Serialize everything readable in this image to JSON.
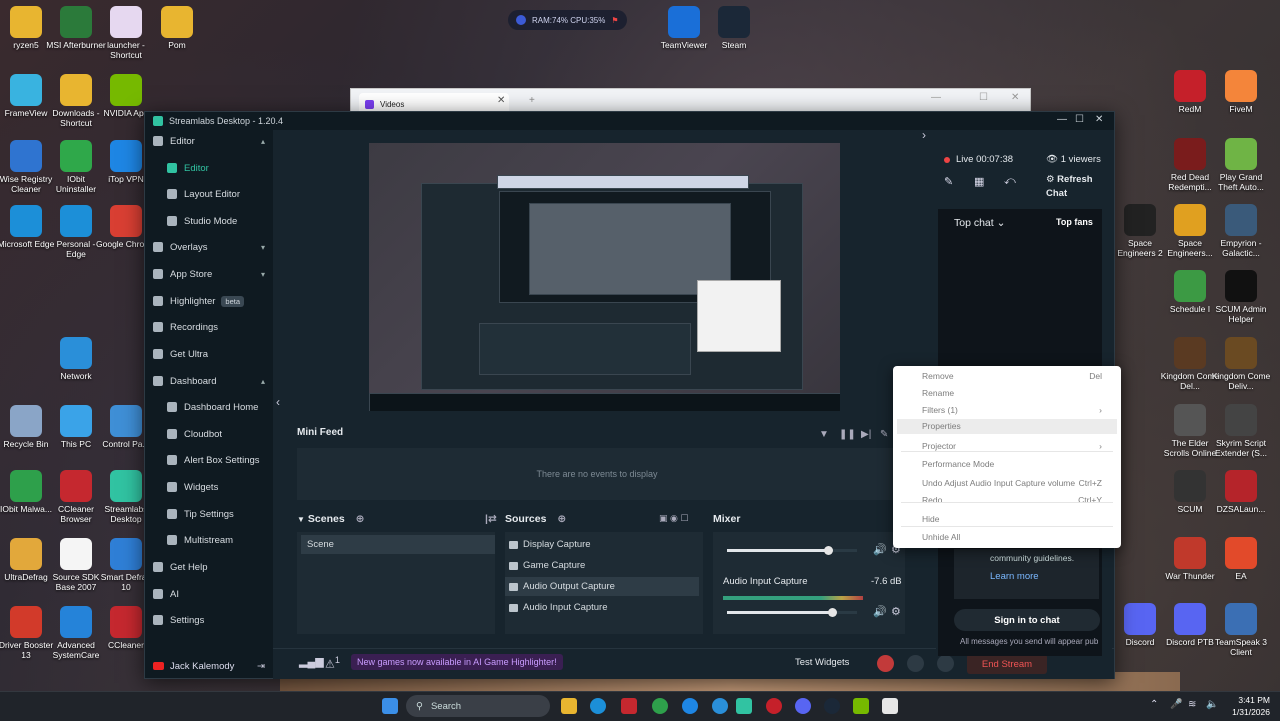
{
  "desktop_left": [
    {
      "label": "ryzen5",
      "color": "#e8b530",
      "glyph": "folder-icon"
    },
    {
      "label": "MSI Afterburner",
      "color": "#2b7a3a",
      "glyph": "afterburner-icon"
    },
    {
      "label": "launcher - Shortcut",
      "color": "#e6d8f0",
      "glyph": "launcher-icon"
    },
    {
      "label": "Pom",
      "color": "#e8b530",
      "glyph": "folder-icon"
    },
    {
      "label": "FrameView",
      "color": "#39b3e0",
      "glyph": "frameview-icon"
    },
    {
      "label": "Downloads - Shortcut",
      "color": "#e8b530",
      "glyph": "folder-icon"
    },
    {
      "label": "NVIDIA App",
      "color": "#76b900",
      "glyph": "nvidia-icon"
    },
    {
      "label": "Wise Registry Cleaner",
      "color": "#2f74d0",
      "glyph": "wise-icon"
    },
    {
      "label": "IObit Uninstaller",
      "color": "#2fa84a",
      "glyph": "iobit-icon"
    },
    {
      "label": "iTop VPN",
      "color": "#1e86e4",
      "glyph": "vpn-icon"
    },
    {
      "label": "Microsoft Edge",
      "color": "#1c8fd8",
      "glyph": "edge-icon"
    },
    {
      "label": "Personal - Edge",
      "color": "#1c8fd8",
      "glyph": "edge-icon"
    },
    {
      "label": "Google Chrome",
      "color": "#d93f33",
      "glyph": "chrome-icon"
    },
    {
      "label": "Network",
      "color": "#2a8fd9",
      "glyph": "network-icon"
    },
    {
      "label": "Recycle Bin",
      "color": "#8aa5c7",
      "glyph": "recycle-bin-icon"
    },
    {
      "label": "This PC",
      "color": "#3aa3e8",
      "glyph": "pc-icon"
    },
    {
      "label": "Control Pa...",
      "color": "#3f8fd6",
      "glyph": "control-panel-icon"
    },
    {
      "label": "IObit Malwa...",
      "color": "#2ea04b",
      "glyph": "malware-icon"
    },
    {
      "label": "CCleaner Browser",
      "color": "#c5282f",
      "glyph": "ccleaner-browser-icon"
    },
    {
      "label": "Streamlabs Desktop",
      "color": "#31c3a2",
      "glyph": "streamlabs-icon"
    },
    {
      "label": "UltraDefrag",
      "color": "#e2a83b",
      "glyph": "defrag-icon"
    },
    {
      "label": "Source SDK Base 2007",
      "color": "#f5f5f5",
      "glyph": "file-icon"
    },
    {
      "label": "Smart Defrag 10",
      "color": "#2f7fd6",
      "glyph": "smart-defrag-icon"
    },
    {
      "label": "Driver Booster 13",
      "color": "#d23a2a",
      "glyph": "driver-booster-icon"
    },
    {
      "label": "Advanced SystemCare",
      "color": "#2583d9",
      "glyph": "asc-icon"
    },
    {
      "label": "CCleaner",
      "color": "#c5282f",
      "glyph": "ccleaner-icon"
    }
  ],
  "desktop_top": [
    {
      "label": "TeamViewer",
      "color": "#1a6fd8",
      "glyph": "teamviewer-icon"
    },
    {
      "label": "Steam",
      "color": "#1b2838",
      "glyph": "steam-icon"
    }
  ],
  "desktop_right": [
    {
      "label": "RedM",
      "color": "#c5202a",
      "glyph": "redm-icon"
    },
    {
      "label": "FiveM",
      "color": "#f4853a",
      "glyph": "fivem-icon"
    },
    {
      "label": "Red Dead Redempti...",
      "color": "#7a1c1c",
      "glyph": "rdr-icon"
    },
    {
      "label": "Play Grand Theft Auto...",
      "color": "#6fb445",
      "glyph": "gta-icon"
    },
    {
      "label": "Space Engineers 2",
      "color": "#222",
      "glyph": "se2-icon"
    },
    {
      "label": "Space Engineers...",
      "color": "#e0a020",
      "glyph": "se-icon"
    },
    {
      "label": "Empyrion - Galactic...",
      "color": "#3a5a7a",
      "glyph": "empyrion-icon"
    },
    {
      "label": "Schedule I",
      "color": "#3c9a44",
      "glyph": "schedule-icon"
    },
    {
      "label": "SCUM Admin Helper",
      "color": "#111",
      "glyph": "scum-helper-icon"
    },
    {
      "label": "Kingdom Come Del...",
      "color": "#5a3a22",
      "glyph": "kcd-icon"
    },
    {
      "label": "Kingdom Come Deliv...",
      "color": "#6a4a22",
      "glyph": "kcd2-icon"
    },
    {
      "label": "The Elder Scrolls Online",
      "color": "#555",
      "glyph": "eso-icon"
    },
    {
      "label": "Skyrim Script Extender (S...",
      "color": "#444",
      "glyph": "skse-icon"
    },
    {
      "label": "SCUM",
      "color": "#333",
      "glyph": "scum-icon"
    },
    {
      "label": "DZSALaun...",
      "color": "#b5242a",
      "glyph": "dzsa-icon"
    },
    {
      "label": "War Thunder",
      "color": "#c0392b",
      "glyph": "war-thunder-icon"
    },
    {
      "label": "EA",
      "color": "#e24a2a",
      "glyph": "ea-icon"
    },
    {
      "label": "Discord",
      "color": "#5865f2",
      "glyph": "discord-icon"
    },
    {
      "label": "Discord PTB",
      "color": "#5865f2",
      "glyph": "discord-icon"
    },
    {
      "label": "TeamSpeak 3 Client",
      "color": "#3b6fb4",
      "glyph": "teamspeak-icon"
    }
  ],
  "perf_overlay": {
    "text": "RAM:74%  CPU:35%"
  },
  "videos_window": {
    "tab_title": "Videos"
  },
  "app": {
    "title": "Streamlabs Desktop - 1.20.4",
    "sidebar": [
      {
        "label": "Editor",
        "type": "head",
        "chev": "^"
      },
      {
        "label": "Editor",
        "type": "sub",
        "active": true
      },
      {
        "label": "Layout Editor",
        "type": "sub"
      },
      {
        "label": "Studio Mode",
        "type": "sub"
      },
      {
        "label": "Overlays",
        "type": "head",
        "chev": "v"
      },
      {
        "label": "App Store",
        "type": "head",
        "chev": "v"
      },
      {
        "label": "Highlighter",
        "type": "head",
        "badge": "beta"
      },
      {
        "label": "Recordings",
        "type": "head"
      },
      {
        "label": "Get Ultra",
        "type": "head"
      },
      {
        "label": "Dashboard",
        "type": "head",
        "chev": "^"
      },
      {
        "label": "Dashboard Home",
        "type": "sub"
      },
      {
        "label": "Cloudbot",
        "type": "sub"
      },
      {
        "label": "Alert Box Settings",
        "type": "sub"
      },
      {
        "label": "Widgets",
        "type": "sub"
      },
      {
        "label": "Tip Settings",
        "type": "sub"
      },
      {
        "label": "Multistream",
        "type": "sub"
      },
      {
        "label": "Get Help",
        "type": "head"
      },
      {
        "label": "AI",
        "type": "head"
      },
      {
        "label": "Settings",
        "type": "head"
      }
    ],
    "user": "Jack Kalemody",
    "mini_feed": {
      "title": "Mini Feed",
      "empty": "There are no events to display"
    },
    "scenes": {
      "title": "Scenes",
      "items": [
        "Scene"
      ]
    },
    "sources": {
      "title": "Sources",
      "items": [
        "Display Capture",
        "Game Capture",
        "Audio Output Capture",
        "Audio Input Capture"
      ],
      "selected": 2
    },
    "mixer": {
      "title": "Mixer",
      "track_label": "Audio Input Capture",
      "track_db": "-7.6 dB",
      "fader1": 0.78,
      "fader2": 0.81
    },
    "footer": {
      "notice": "New games now available in AI Game Highlighter!",
      "notice_count": "1",
      "test_widgets": "Test Widgets",
      "end_stream": "End Stream"
    },
    "chat": {
      "live": "Live 00:07:38",
      "viewers": "1 viewers",
      "refresh": "Refresh Chat",
      "top_chat": "Top chat",
      "top_fans": "Top fans",
      "guidelines": "community guidelines.",
      "learn_more": "Learn more",
      "sign_in": "Sign in to chat",
      "all_messages": "All messages you send will appear pub"
    }
  },
  "context_menu": [
    {
      "label": "Remove",
      "shortcut": "Del"
    },
    {
      "label": "Rename",
      "shortcut": ""
    },
    {
      "label": "Filters (1)",
      "shortcut": "›"
    },
    {
      "label": "Properties",
      "shortcut": "",
      "hover": true
    },
    {
      "label": "Projector",
      "shortcut": "›"
    },
    {
      "label": "Performance Mode",
      "shortcut": ""
    },
    {
      "label": "Undo Adjust Audio Input Capture volume",
      "shortcut": "Ctrl+Z"
    },
    {
      "label": "Redo",
      "shortcut": "Ctrl+Y"
    },
    {
      "label": "Hide",
      "shortcut": ""
    },
    {
      "label": "Unhide All",
      "shortcut": ""
    }
  ],
  "taskbar": {
    "search_placeholder": "Search",
    "time": "3:41 PM",
    "date": "1/31/2026"
  }
}
